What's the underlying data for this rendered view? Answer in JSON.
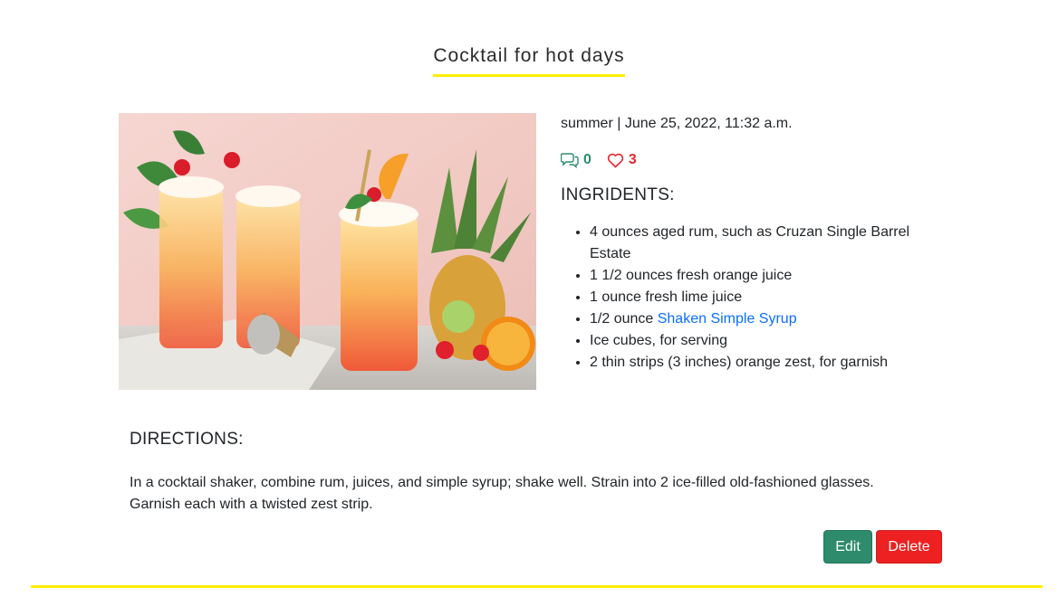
{
  "post": {
    "title": "Cocktail for hot days",
    "meta": "summer | June 25, 2022, 11:32 a.m.",
    "image_icon": "cocktail-photo",
    "comment_count": "0",
    "like_count": "3"
  },
  "ingredients": {
    "heading": "INGRIDENTS:",
    "items": [
      "4 ounces aged rum, such as Cruzan Single Barrel Estate",
      "1 1/2 ounces fresh orange juice",
      "1 ounce fresh lime juice",
      {
        "prefix": "1/2 ounce ",
        "link": "Shaken Simple Syrup"
      },
      "Ice cubes, for serving",
      "2 thin strips (3 inches) orange zest, for garnish"
    ]
  },
  "directions": {
    "heading": "DIRECTIONS:",
    "text": "In a cocktail shaker, combine rum, juices, and simple syrup; shake well. Strain into 2 ice-filled old-fashioned glasses. Garnish each with a twisted zest strip."
  },
  "actions": {
    "edit": "Edit",
    "delete": "Delete"
  },
  "colors": {
    "accent_yellow": "#ffee00",
    "edit_green": "#2e8b6b",
    "delete_red": "#ed2121",
    "like_red": "#e8262f",
    "link_blue": "#0d6efd"
  }
}
